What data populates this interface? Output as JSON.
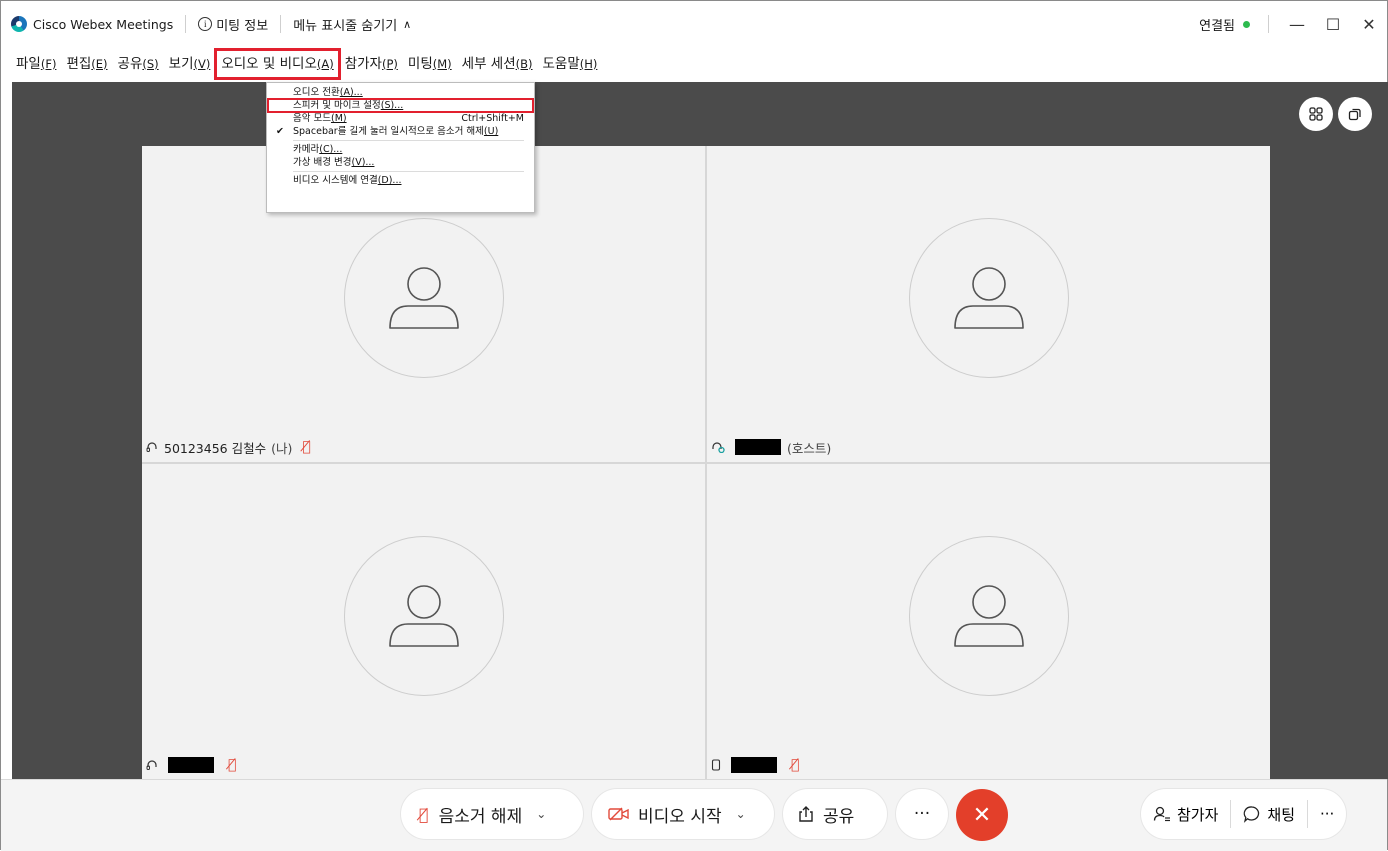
{
  "titlebar": {
    "app_title": "Cisco Webex Meetings",
    "meeting_info": "미팅 정보",
    "hide_menu": "메뉴 표시줄 숨기기",
    "connection_status": "연결됨"
  },
  "menubar": [
    {
      "label": "파일",
      "acc": "(F)"
    },
    {
      "label": "편집",
      "acc": "(E)"
    },
    {
      "label": "공유",
      "acc": "(S)"
    },
    {
      "label": "보기",
      "acc": "(V)"
    },
    {
      "label": "오디오 및 비디오",
      "acc": "(A)"
    },
    {
      "label": "참가자",
      "acc": "(P)"
    },
    {
      "label": "미팅",
      "acc": "(M)"
    },
    {
      "label": "세부 세션",
      "acc": "(B)"
    },
    {
      "label": "도움말",
      "acc": "(H)"
    }
  ],
  "dropdown": {
    "items": [
      {
        "label": "오디오 전환",
        "acc": "(A)...",
        "shortcut": "",
        "checked": false
      },
      {
        "label": "스피커 및 마이크 설정",
        "acc": "(S)...",
        "shortcut": "",
        "checked": false
      },
      {
        "label": "음악 모드",
        "acc": "(M)",
        "shortcut": "Ctrl+Shift+M",
        "checked": false
      },
      {
        "label": "Spacebar를 길게 눌러 일시적으로 음소거 해제",
        "acc": "(U)",
        "shortcut": "",
        "checked": true
      },
      {
        "label": "카메라",
        "acc": "(C)...",
        "shortcut": "",
        "checked": false
      },
      {
        "label": "가상 배경 변경",
        "acc": "(V)...",
        "shortcut": "",
        "checked": false
      },
      {
        "label": "비디오 시스템에 연결",
        "acc": "(D)...",
        "shortcut": "",
        "checked": false
      }
    ]
  },
  "participants": [
    {
      "name": "50123456 김철수",
      "role": "(나)",
      "device": "headset-icon",
      "muted": true,
      "redacted": false
    },
    {
      "name": "",
      "role": "(호스트)",
      "device": "headset-active-icon",
      "muted": false,
      "redacted": true
    },
    {
      "name": "",
      "role": "",
      "device": "headset-icon",
      "muted": true,
      "redacted": true
    },
    {
      "name": "",
      "role": "",
      "device": "phone-icon",
      "muted": true,
      "redacted": true
    }
  ],
  "controls": {
    "unmute": "음소거 해제",
    "start_video": "비디오 시작",
    "share": "공유",
    "more": "···",
    "participants": "참가자",
    "chat": "채팅",
    "more_right": "···"
  },
  "colors": {
    "highlight": "#e2202e",
    "end_call": "#e33f2a",
    "muted": "#e24a3b",
    "connected": "#2dbb4e",
    "stage": "#4b4b4b"
  }
}
